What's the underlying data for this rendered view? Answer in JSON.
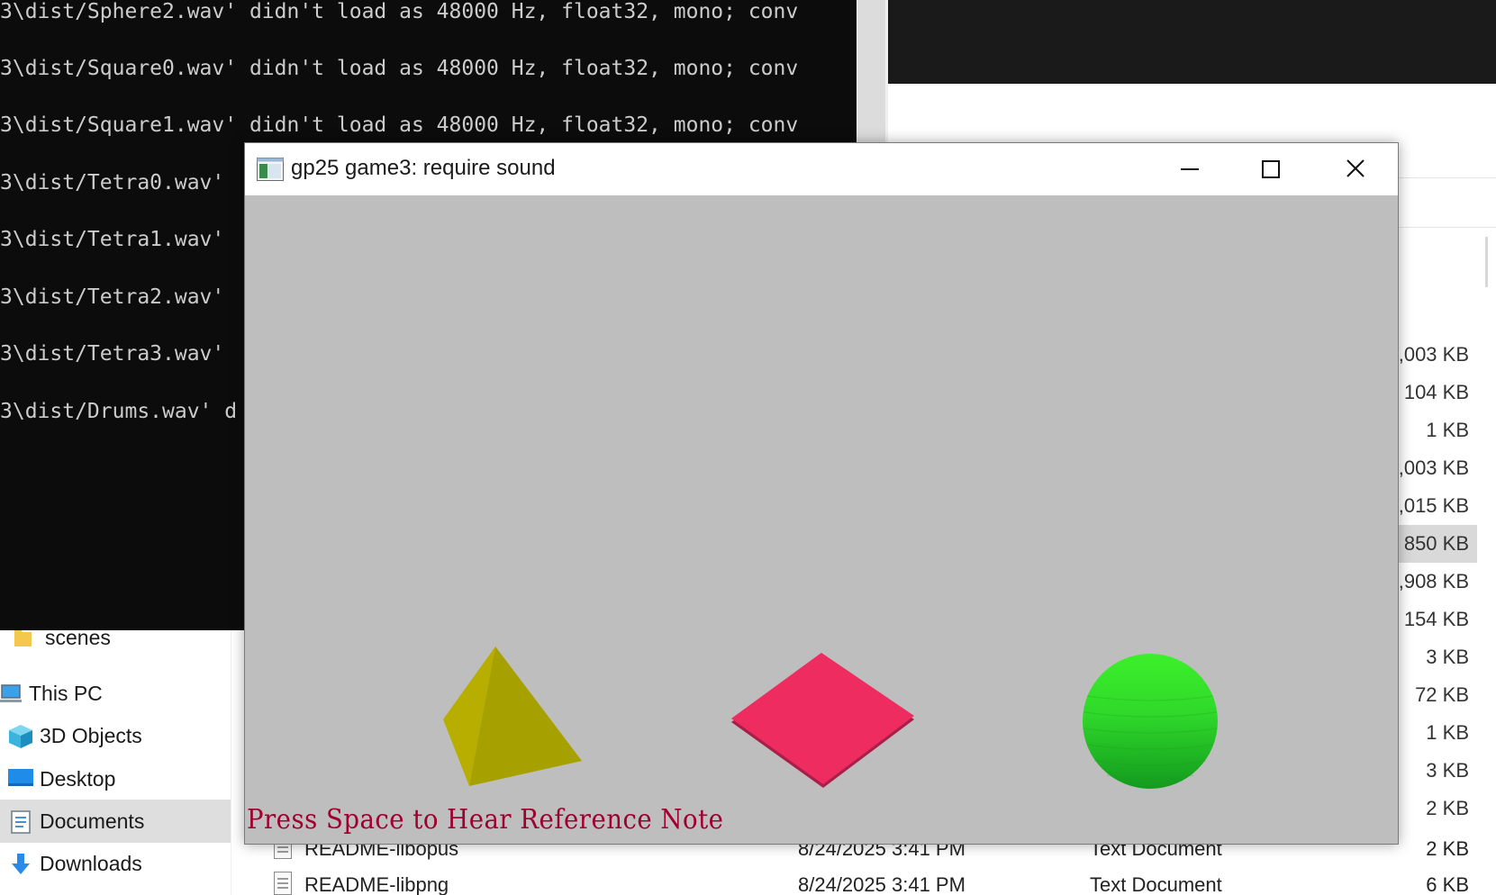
{
  "explorer": {
    "nav_items": [
      {
        "label": "scenes",
        "icon": "folder-icon"
      },
      {
        "label": "This PC",
        "icon": "computer-icon"
      },
      {
        "label": "3D Objects",
        "icon": "cube-icon"
      },
      {
        "label": "Desktop",
        "icon": "desktop-icon"
      },
      {
        "label": "Documents",
        "icon": "documents-icon",
        "selected": true
      },
      {
        "label": "Downloads",
        "icon": "downloads-icon"
      }
    ],
    "sizes": [
      ",003 KB",
      "104 KB",
      "1 KB",
      ",003 KB",
      ",015 KB",
      "850 KB",
      ",908 KB",
      "154 KB",
      "3 KB",
      "72 KB",
      "1 KB",
      "3 KB",
      "2 KB"
    ],
    "files": [
      {
        "name": "README-libopus",
        "date": "8/24/2025 3:41 PM",
        "type": "Text Document",
        "size": "2 KB"
      },
      {
        "name": "README-libpng",
        "date": "8/24/2025 3:41 PM",
        "type": "Text Document",
        "size": "6 KB"
      }
    ]
  },
  "console": {
    "lines": [
      "3\\dist/Sphere2.wav' didn't load as 48000 Hz, float32, mono; conv",
      "3\\dist/Square0.wav' didn't load as 48000 Hz, float32, mono; conv",
      "3\\dist/Square1.wav' didn't load as 48000 Hz, float32, mono; conv",
      "3\\dist/Tetra0.wav'",
      "3\\dist/Tetra1.wav'",
      "3\\dist/Tetra2.wav'",
      "3\\dist/Tetra3.wav'",
      "3\\dist/Drums.wav' d"
    ]
  },
  "game_window": {
    "title": "gp25 game3: require sound",
    "icon": "app-window-icon",
    "prompt": "Press Space to Hear Reference Note",
    "colors": {
      "background": "#bebebe",
      "tetrahedron": "#a8a000",
      "square": "#ee2c60",
      "sphere": "#2ee82a",
      "prompt": "#a00030"
    },
    "shapes": [
      "tetrahedron",
      "square",
      "sphere"
    ]
  }
}
